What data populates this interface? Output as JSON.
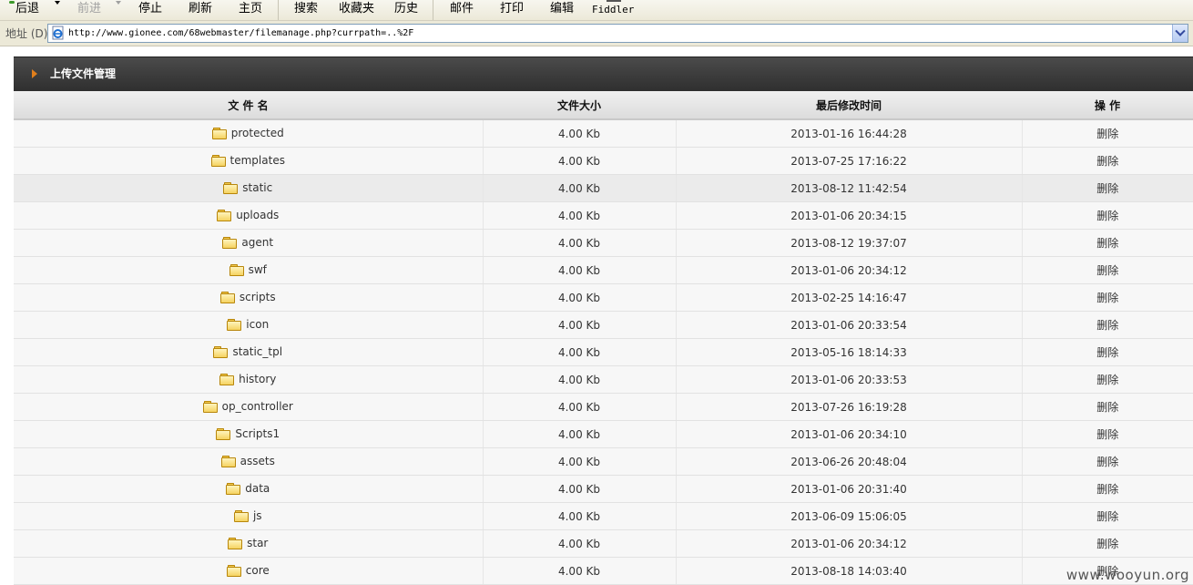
{
  "toolbar": {
    "back": "后退",
    "forward": "前进",
    "stop": "停止",
    "refresh": "刷新",
    "home": "主页",
    "search": "搜索",
    "favorites": "收藏夹",
    "history": "历史",
    "mail": "邮件",
    "print": "打印",
    "edit": "编辑",
    "fiddler": "Fiddler"
  },
  "address": {
    "label": "地址 (D)",
    "url": "http://www.gionee.com/68webmaster/filemanage.php?currpath=..%2F",
    "icon": "ie-page-icon"
  },
  "panel": {
    "title": "上传文件管理",
    "columns": {
      "name": "文 件 名",
      "size": "文件大小",
      "modified": "最后修改时间",
      "action": "操 作"
    },
    "rows": [
      {
        "name": "protected",
        "size": "4.00 Kb",
        "modified": "2013-01-16 16:44:28",
        "action": "删除"
      },
      {
        "name": "templates",
        "size": "4.00 Kb",
        "modified": "2013-07-25 17:16:22",
        "action": "删除"
      },
      {
        "name": "static",
        "size": "4.00 Kb",
        "modified": "2013-08-12 11:42:54",
        "action": "删除"
      },
      {
        "name": "uploads",
        "size": "4.00 Kb",
        "modified": "2013-01-06 20:34:15",
        "action": "删除"
      },
      {
        "name": "agent",
        "size": "4.00 Kb",
        "modified": "2013-08-12 19:37:07",
        "action": "删除"
      },
      {
        "name": "swf",
        "size": "4.00 Kb",
        "modified": "2013-01-06 20:34:12",
        "action": "删除"
      },
      {
        "name": "scripts",
        "size": "4.00 Kb",
        "modified": "2013-02-25 14:16:47",
        "action": "删除"
      },
      {
        "name": "icon",
        "size": "4.00 Kb",
        "modified": "2013-01-06 20:33:54",
        "action": "删除"
      },
      {
        "name": "static_tpl",
        "size": "4.00 Kb",
        "modified": "2013-05-16 18:14:33",
        "action": "删除"
      },
      {
        "name": "history",
        "size": "4.00 Kb",
        "modified": "2013-01-06 20:33:53",
        "action": "删除"
      },
      {
        "name": "op_controller",
        "size": "4.00 Kb",
        "modified": "2013-07-26 16:19:28",
        "action": "删除"
      },
      {
        "name": "Scripts1",
        "size": "4.00 Kb",
        "modified": "2013-01-06 20:34:10",
        "action": "删除"
      },
      {
        "name": "assets",
        "size": "4.00 Kb",
        "modified": "2013-06-26 20:48:04",
        "action": "删除"
      },
      {
        "name": "data",
        "size": "4.00 Kb",
        "modified": "2013-01-06 20:31:40",
        "action": "删除"
      },
      {
        "name": "js",
        "size": "4.00 Kb",
        "modified": "2013-06-09 15:06:05",
        "action": "删除"
      },
      {
        "name": "star",
        "size": "4.00 Kb",
        "modified": "2013-01-06 20:34:12",
        "action": "删除"
      },
      {
        "name": "core",
        "size": "4.00 Kb",
        "modified": "2013-08-18 14:03:40",
        "action": "删除"
      }
    ],
    "highlighted_row": 2
  },
  "watermark": "www.wooyun.org",
  "colors": {
    "panel_header": "#3a3a3a",
    "accent_arrow": "#e07f1c",
    "folder": "#f5d360"
  }
}
